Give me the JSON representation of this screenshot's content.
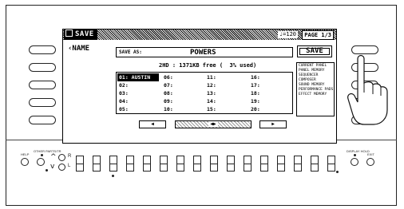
{
  "screen": {
    "title": "SAVE",
    "tempo": "♩=120",
    "page": "PAGE 1/3",
    "name_label": "NAME",
    "save_as_label": "SAVE AS:",
    "filename": "POWERS",
    "save_button": "SAVE",
    "disk_info": "2HD : 1371KB free (  3% used)",
    "slots": [
      [
        "01: AUSTIN",
        "02:",
        "03:",
        "04:",
        "05:"
      ],
      [
        "06:",
        "07:",
        "08:",
        "09:",
        "10:"
      ],
      [
        "11:",
        "12:",
        "13:",
        "14:",
        "15:"
      ],
      [
        "16:",
        "17:",
        "18:",
        "19:",
        "20:"
      ]
    ],
    "selected_slot": "01: AUSTIN",
    "info_items": [
      "CURRENT PANEL",
      "PANEL MEMORY",
      "SEQUENCER",
      "COMPOSER",
      "SOUND MEMORY",
      "PERFORMANCE PADS",
      "EFFECT MEMORY"
    ],
    "nav": {
      "prev": "◀",
      "scroll": "◀▶",
      "next": "▶"
    }
  },
  "panel": {
    "help_label": "HELP",
    "other_parts_label": "OTHER PARTS/TR",
    "lower_label": "L",
    "right_label": "R",
    "page_label": "PAGE",
    "display_hold_label": "DISPLAY HOLD",
    "exit_label": "EXIT"
  }
}
